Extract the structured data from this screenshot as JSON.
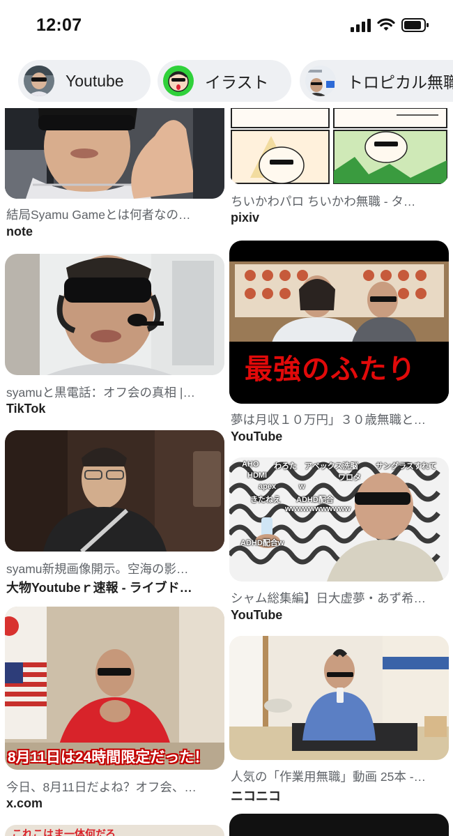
{
  "status_bar": {
    "time": "12:07"
  },
  "chips": [
    {
      "label": "Youtube"
    },
    {
      "label": "イラスト"
    },
    {
      "label": "トロピカル無職"
    }
  ],
  "results": {
    "left": [
      {
        "caption": "結局Syamu Gameとは何者なの…",
        "source": "note"
      },
      {
        "caption": "syamuと黒電話：オフ会の真相 |…",
        "source": "TikTok"
      },
      {
        "caption": "syamu新規画像開示。空海の影…",
        "source": "大物Youtubeｒ速報 - ライブド…"
      },
      {
        "caption": "今日、8月11日だよね？オフ会、…",
        "source": "x.com",
        "overlay": "8月11日は24時間限定だった！"
      }
    ],
    "right": [
      {
        "caption": "ちいかわパロ ちいかわ無職 - タ…",
        "source": "pixiv"
      },
      {
        "caption": "夢は月収１０万円」３０歳無職と…",
        "source": "YouTube",
        "overlay": "最強のふたり"
      },
      {
        "caption": "シャム総集編】日大虚夢・あず希…",
        "source": "YouTube",
        "overlay_comments": [
          "AHO",
          "わろた",
          "アベックス洗脳",
          "サングラスすれて",
          "HDMI",
          "ワロタ",
          "apex",
          "w",
          "きたねえ",
          "ADHD配合",
          "wwwwwwwwwww",
          "ADHD配合w"
        ]
      },
      {
        "caption": "人気の「作業用無職」動画 25本 -…",
        "source": "ニコニコ"
      }
    ],
    "partial_bottom_left_text": "これこはま一体何だろ"
  }
}
